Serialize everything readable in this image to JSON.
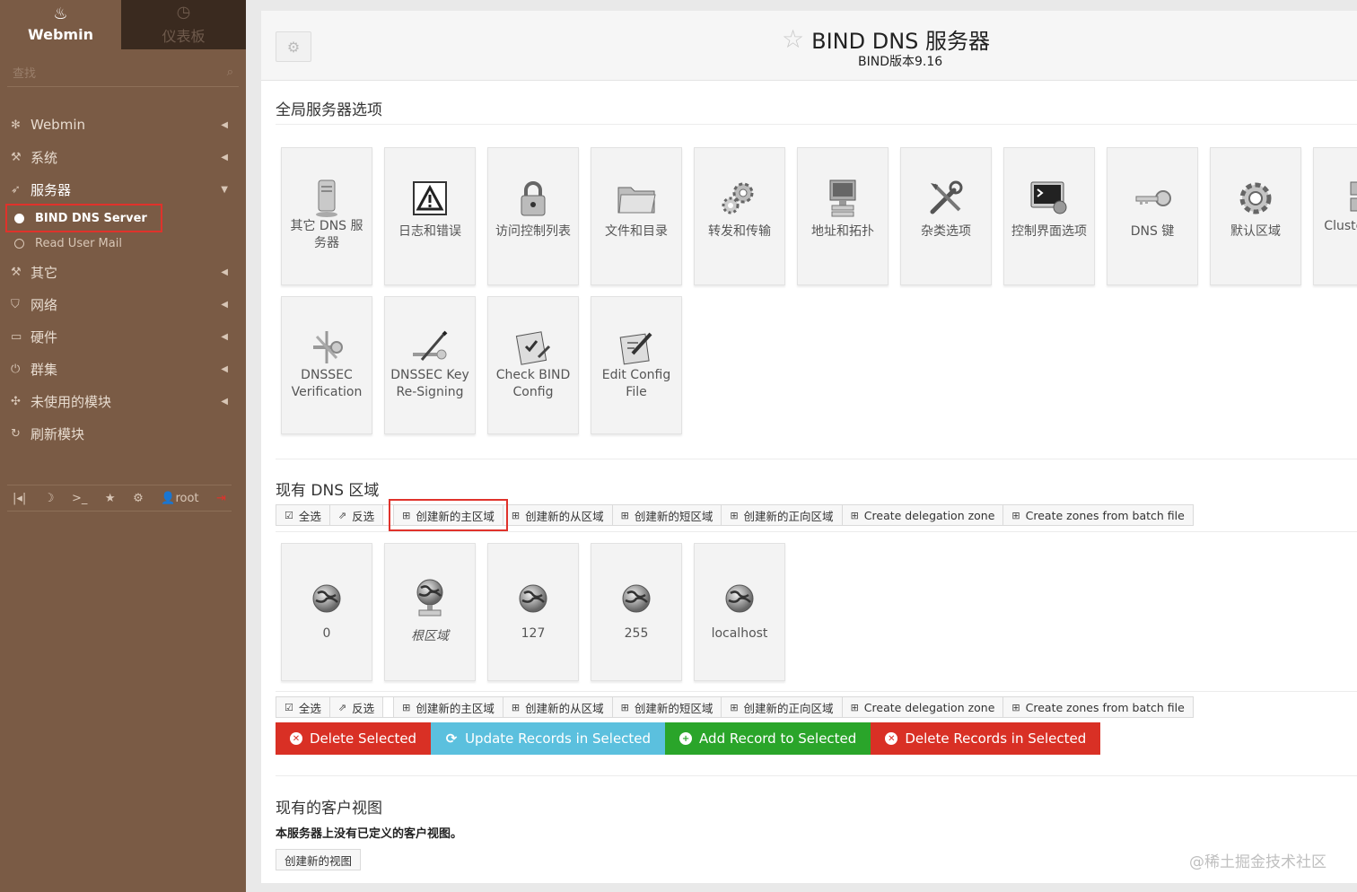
{
  "sidebar": {
    "tabs": [
      {
        "label": "Webmin",
        "icon": "webmin-icon",
        "active": true
      },
      {
        "label": "仪表板",
        "icon": "dashboard-icon",
        "active": false
      }
    ],
    "search": {
      "placeholder": "查找"
    },
    "items": [
      {
        "label": "Webmin",
        "icon": "gear-icon"
      },
      {
        "label": "系统",
        "icon": "wrench-icon"
      },
      {
        "label": "服务器",
        "icon": "rocket-icon",
        "open": true
      },
      {
        "label": "其它",
        "icon": "hammer-icon"
      },
      {
        "label": "网络",
        "icon": "shield-icon"
      },
      {
        "label": "硬件",
        "icon": "drive-icon"
      },
      {
        "label": "群集",
        "icon": "power-icon"
      },
      {
        "label": "未使用的模块",
        "icon": "puzzle-icon"
      },
      {
        "label": "刷新模块",
        "icon": "refresh-icon"
      }
    ],
    "subitems": [
      {
        "label": "BIND DNS Server",
        "active": true
      },
      {
        "label": "Read User Mail",
        "active": false
      }
    ],
    "footer": {
      "user": "root"
    }
  },
  "header": {
    "title": "BIND DNS 服务器",
    "subtitle": "BIND版本9.16"
  },
  "global": {
    "title": "全局服务器选项",
    "tiles": [
      {
        "label": "其它 DNS 服务器",
        "icon": "server-icon"
      },
      {
        "label": "日志和错误",
        "icon": "warning-icon"
      },
      {
        "label": "访问控制列表",
        "icon": "padlock-icon"
      },
      {
        "label": "文件和目录",
        "icon": "folder-icon"
      },
      {
        "label": "转发和传输",
        "icon": "gears-icon"
      },
      {
        "label": "地址和拓扑",
        "icon": "monitor-icon"
      },
      {
        "label": "杂类选项",
        "icon": "tools-icon"
      },
      {
        "label": "控制界面选项",
        "icon": "terminal-icon"
      },
      {
        "label": "DNS 键",
        "icon": "key-icon"
      },
      {
        "label": "默认区域",
        "icon": "cog-icon"
      },
      {
        "label": "Cluster Ser",
        "icon": "cluster-icon"
      },
      {
        "label": "DNSSEC Verification",
        "icon": "keys-icon"
      },
      {
        "label": "DNSSEC Key Re-Signing",
        "icon": "pen-key-icon"
      },
      {
        "label": "Check BIND Config",
        "icon": "checklist-icon"
      },
      {
        "label": "Edit Config File",
        "icon": "edit-icon"
      }
    ]
  },
  "zones": {
    "title": "现有 DNS 区域",
    "toolbar": [
      {
        "label": "全选",
        "icon": "check-icon"
      },
      {
        "label": "反选",
        "icon": "share-icon"
      },
      {
        "label": "创建新的主区域",
        "icon": "plus-square-icon"
      },
      {
        "label": "创建新的从区域",
        "icon": "plus-square-icon"
      },
      {
        "label": "创建新的短区域",
        "icon": "plus-square-icon"
      },
      {
        "label": "创建新的正向区域",
        "icon": "plus-square-icon"
      },
      {
        "label": "Create delegation zone",
        "icon": "plus-square-icon"
      },
      {
        "label": "Create zones from batch file",
        "icon": "plus-square-icon"
      }
    ],
    "tiles": [
      {
        "label": "0"
      },
      {
        "label": "根区域"
      },
      {
        "label": "127"
      },
      {
        "label": "255"
      },
      {
        "label": "localhost"
      }
    ],
    "actions": [
      {
        "label": "Delete Selected",
        "color": "#d93025"
      },
      {
        "label": "Update Records in Selected",
        "color": "#5bc0de"
      },
      {
        "label": "Add Record to Selected",
        "color": "#2aa52a"
      },
      {
        "label": "Delete Records in Selected",
        "color": "#d93025"
      }
    ]
  },
  "views": {
    "title": "现有的客户视图",
    "note": "本服务器上没有已定义的客户视图。",
    "button": "创建新的视图"
  },
  "watermark": "@稀土掘金技术社区"
}
